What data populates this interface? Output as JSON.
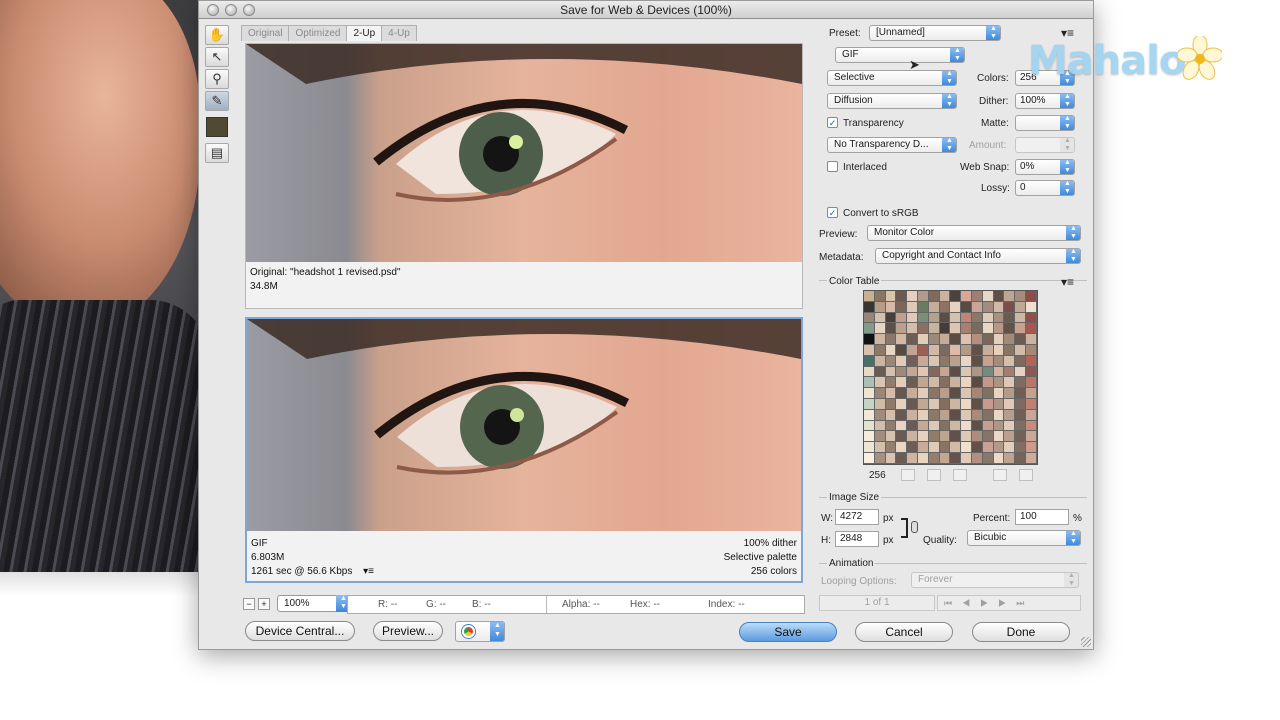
{
  "window": {
    "title": "Save for Web & Devices (100%)"
  },
  "tabs": [
    {
      "label": "Original",
      "active": false
    },
    {
      "label": "Optimized",
      "active": false
    },
    {
      "label": "2-Up",
      "active": true
    },
    {
      "label": "4-Up",
      "active": false
    }
  ],
  "original_pane": {
    "line1": "Original: \"headshot 1 revised.psd\"",
    "line2": "34.8M"
  },
  "optimized_pane": {
    "format": "GIF",
    "size": "6.803M",
    "download": "1261 sec @ 56.6 Kbps",
    "dither": "100% dither",
    "palette": "Selective palette",
    "colors": "256 colors"
  },
  "status": {
    "zoom": "100%",
    "r": "R: --",
    "g": "G: --",
    "b": "B: --",
    "alpha": "Alpha: --",
    "hex": "Hex: --",
    "index": "Index: --"
  },
  "buttons": {
    "device_central": "Device Central...",
    "preview": "Preview...",
    "save": "Save",
    "cancel": "Cancel",
    "done": "Done"
  },
  "settings": {
    "preset_label": "Preset:",
    "preset_value": "[Unnamed]",
    "format": "GIF",
    "reduction": "Selective",
    "colors_label": "Colors:",
    "colors_value": "256",
    "dither_algo": "Diffusion",
    "dither_label": "Dither:",
    "dither_value": "100%",
    "transparency_label": "Transparency",
    "transparency_checked": true,
    "matte_label": "Matte:",
    "matte_value": "",
    "transparency_dither": "No Transparency D...",
    "amount_label": "Amount:",
    "amount_value": "",
    "interlaced_label": "Interlaced",
    "interlaced_checked": false,
    "websnap_label": "Web Snap:",
    "websnap_value": "0%",
    "lossy_label": "Lossy:",
    "lossy_value": "0",
    "srgb_label": "Convert to sRGB",
    "srgb_checked": true,
    "preview_label": "Preview:",
    "preview_value": "Monitor Color",
    "metadata_label": "Metadata:",
    "metadata_value": "Copyright and Contact Info"
  },
  "color_table": {
    "title": "Color Table",
    "count": "256",
    "swatches": [
      "#c7b08f",
      "#8a7562",
      "#d9c4a8",
      "#6b5a4d",
      "#e4cfc0",
      "#b3998a",
      "#7e6b5e",
      "#cab49f",
      "#4d433e",
      "#d8a79a",
      "#9f7f73",
      "#e6d8c6",
      "#5e5048",
      "#bea58f",
      "#a48b7a",
      "#8f4d4a",
      "#3a3532",
      "#b89c88",
      "#d9b7a8",
      "#7c6658",
      "#ddc9b5",
      "#6a7b63",
      "#c4ad9b",
      "#8d7362",
      "#e8d2bf",
      "#574b45",
      "#caa595",
      "#a28c7e",
      "#d0b9a6",
      "#784f4a",
      "#bfa894",
      "#efe0cd",
      "#9a8674",
      "#d4c0b0",
      "#483f3a",
      "#c39e8e",
      "#e2c8b7",
      "#7a8f7a",
      "#b2a18c",
      "#5b4c44",
      "#d6c1ad",
      "#c28476",
      "#8c7868",
      "#e0cbb8",
      "#a9917f",
      "#6a5a50",
      "#cdb7a3",
      "#934e47",
      "#7f9b8c",
      "#e5d4c1",
      "#5d5049",
      "#bba18d",
      "#d7bcac",
      "#8b6f62",
      "#c8b39f",
      "#453c38",
      "#dcc5b3",
      "#a7806f",
      "#7b6a5e",
      "#e9d7c5",
      "#b69887",
      "#62534a",
      "#c9a08f",
      "#a5584d",
      "#111111",
      "#cdb6a4",
      "#8a786a",
      "#d3b8a5",
      "#6d5d54",
      "#e2cdb9",
      "#9e8878",
      "#c5ab98",
      "#5a4b43",
      "#d9c3b0",
      "#b58e7e",
      "#7a675b",
      "#e4d0bd",
      "#a38b79",
      "#6b5b51",
      "#ccb29f",
      "#d7c1ae",
      "#8e7969",
      "#e7d5c3",
      "#574a43",
      "#c1a491",
      "#9c5f55",
      "#d0baa7",
      "#7a6a60",
      "#deb9a7",
      "#b39a88",
      "#605149",
      "#c8ad9a",
      "#e5cfbd",
      "#8a7464",
      "#d2bca9",
      "#a68a78",
      "#4a6e6a",
      "#cbb5a2",
      "#9b8777",
      "#e1cbb8",
      "#6f5f56",
      "#c6a997",
      "#dac4b2",
      "#8d7767",
      "#b9a18f",
      "#e8d6c4",
      "#5f5047",
      "#c99f8f",
      "#a38e7d",
      "#d5bfac",
      "#7c6a5f",
      "#b3645a",
      "#e9d8c6",
      "#6b5c53",
      "#d4c0ad",
      "#9f8979",
      "#c3a693",
      "#e0c7b5",
      "#82695c",
      "#caa493",
      "#5c4e46",
      "#dbc6b3",
      "#ae9685",
      "#778a7e",
      "#d3b39f",
      "#a17f6f",
      "#e6d2c0",
      "#8c5a52",
      "#aac0b4",
      "#d8c4b1",
      "#927c6c",
      "#e4cebb",
      "#6c5c52",
      "#bfa592",
      "#d1baa7",
      "#856f61",
      "#c9b29f",
      "#e9d5c2",
      "#5a4c44",
      "#c49788",
      "#a99382",
      "#ddc8b5",
      "#7e6c61",
      "#b6786c",
      "#efe3d2",
      "#9b8575",
      "#d5bcaa",
      "#665750",
      "#c8ad9b",
      "#e3ccba",
      "#8b7566",
      "#b89e8c",
      "#5d4f48",
      "#d9c5b2",
      "#a88676",
      "#7f7064",
      "#e7d3c0",
      "#b49b89",
      "#6e5e55",
      "#c7a18f",
      "#c6d4c8",
      "#d0bba8",
      "#8f7b6c",
      "#e6d1bf",
      "#695a51",
      "#c2a794",
      "#dbc6b3",
      "#846e60",
      "#ccb5a2",
      "#ebd9c7",
      "#5e4f47",
      "#c69b8b",
      "#ab9584",
      "#dfc9b6",
      "#7d6b60",
      "#c28070",
      "#f2e8d9",
      "#a08a7a",
      "#d6beac",
      "#675850",
      "#cab09e",
      "#e5cebc",
      "#8e7868",
      "#bba28f",
      "#604f48",
      "#dac7b4",
      "#ac8a7a",
      "#827266",
      "#e9d6c4",
      "#b79e8c",
      "#705f56",
      "#c9a595",
      "#e3e1cf",
      "#d2bdab",
      "#917d6e",
      "#e8d4c2",
      "#6b5c53",
      "#c4a997",
      "#ddc8b6",
      "#867062",
      "#ceb7a4",
      "#eddccb",
      "#604f47",
      "#c89e8e",
      "#ae9786",
      "#e1cbb9",
      "#7f6d62",
      "#c98a7a",
      "#f5ecdd",
      "#a38d7d",
      "#d8c1af",
      "#695a52",
      "#ccb2a0",
      "#e7d0be",
      "#917b6b",
      "#bea592",
      "#62504a",
      "#dcc9b6",
      "#af8d7d",
      "#857569",
      "#ebd8c6",
      "#baa18f",
      "#726158",
      "#cba998",
      "#ece7d4",
      "#d4bfad",
      "#947f70",
      "#ead6c4",
      "#6d5e55",
      "#c6ac99",
      "#dfcab8",
      "#897364",
      "#d0b9a6",
      "#efdfcd",
      "#635149",
      "#caa191",
      "#b19a89",
      "#e3cebb",
      "#816f64",
      "#d09a8a",
      "#f7f0e2",
      "#a69080",
      "#dac3b1",
      "#6b5c54",
      "#ceb5a3",
      "#e9d3c1",
      "#947e6e",
      "#c1a895",
      "#65524b",
      "#dfcbb8",
      "#b29080",
      "#88786c",
      "#edd9c8",
      "#bda492",
      "#75645b",
      "#ceab9b"
    ]
  },
  "image_size": {
    "title": "Image Size",
    "w_label": "W:",
    "w_value": "4272",
    "h_label": "H:",
    "h_value": "2848",
    "unit": "px",
    "percent_label": "Percent:",
    "percent_value": "100",
    "percent_unit": "%",
    "quality_label": "Quality:",
    "quality_value": "Bicubic"
  },
  "animation": {
    "title": "Animation",
    "looping_label": "Looping Options:",
    "looping_value": "Forever",
    "frame": "1 of 1"
  },
  "watermark": {
    "text": "Mahalo"
  }
}
